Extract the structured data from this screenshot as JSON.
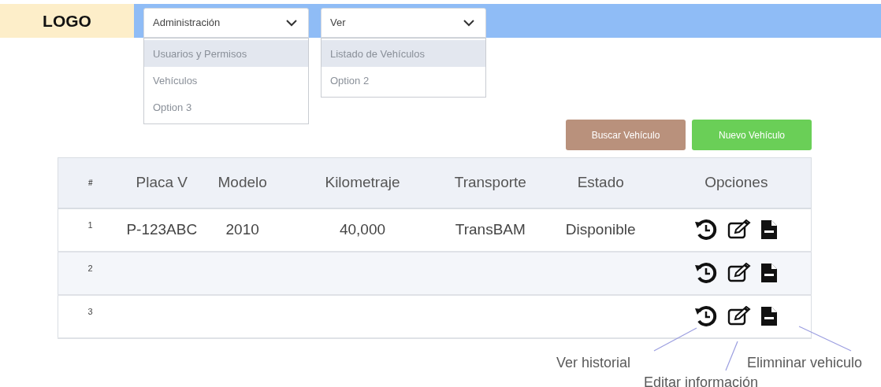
{
  "logo": "LOGO",
  "menus": [
    {
      "label": "Administración",
      "items": [
        {
          "label": "Usuarios y Permisos",
          "selected": true
        },
        {
          "label": "Vehículos",
          "selected": false
        },
        {
          "label": "Option 3",
          "selected": false
        }
      ]
    },
    {
      "label": "Ver",
      "items": [
        {
          "label": "Listado de Vehículos",
          "selected": true
        },
        {
          "label": "Option 2",
          "selected": false
        }
      ]
    }
  ],
  "buttons": [
    {
      "label": "Buscar Vehículo",
      "kind": "search"
    },
    {
      "label": "Nuevo Vehículo",
      "kind": "new"
    }
  ],
  "table": {
    "columns": [
      "#",
      "Placa V",
      "Modelo",
      "Kilometraje",
      "Transporte",
      "Estado",
      "Opciones"
    ],
    "rows": [
      {
        "cells": [
          "1",
          "P-123ABC",
          "2010",
          "40,000",
          "TransBAM",
          "Disponible"
        ]
      },
      {
        "cells": [
          "2"
        ]
      },
      {
        "cells": [
          "3"
        ]
      }
    ]
  },
  "annotations": [
    "Ver historial",
    "Editar información",
    "Elimninar vehiculo"
  ]
}
